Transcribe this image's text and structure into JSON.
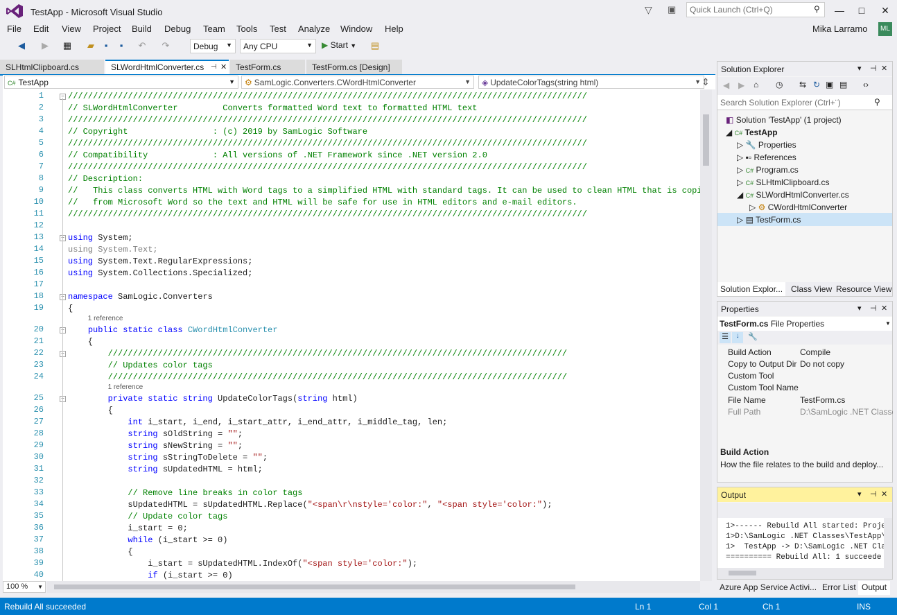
{
  "app": {
    "title": "TestApp - Microsoft Visual Studio",
    "quick_launch": "Quick Launch (Ctrl+Q)",
    "user": "Mika Larramo",
    "user_initials": "ML"
  },
  "menu": [
    "File",
    "Edit",
    "View",
    "Project",
    "Build",
    "Debug",
    "Team",
    "Tools",
    "Test",
    "Analyze",
    "Window",
    "Help"
  ],
  "toolbar": {
    "config": "Debug",
    "platform": "Any CPU",
    "start": "Start"
  },
  "tabs": [
    "SLHtmlClipboard.cs",
    "SLWordHtmlConverter.cs",
    "TestForm.cs",
    "TestForm.cs [Design]"
  ],
  "nav": {
    "project": "TestApp",
    "class": "SamLogic.Converters.CWordHtmlConverter",
    "member": "UpdateColorTags(string html)"
  },
  "code": [
    {
      "n": "1",
      "fold": "−",
      "t": "////////////////////////////////////////////////////////////////////////////////////////////////////////",
      "c": "cm"
    },
    {
      "n": "2",
      "t": "// SLWordHtmlConverter         Converts formatted Word text to formatted HTML text",
      "c": "cm"
    },
    {
      "n": "3",
      "t": "////////////////////////////////////////////////////////////////////////////////////////////////////////",
      "c": "cm"
    },
    {
      "n": "4",
      "t": "// Copyright                 : (c) 2019 by SamLogic Software",
      "c": "cm"
    },
    {
      "n": "5",
      "t": "////////////////////////////////////////////////////////////////////////////////////////////////////////",
      "c": "cm"
    },
    {
      "n": "6",
      "t": "// Compatibility             : All versions of .NET Framework since .NET version 2.0",
      "c": "cm"
    },
    {
      "n": "7",
      "t": "////////////////////////////////////////////////////////////////////////////////////////////////////////",
      "c": "cm"
    },
    {
      "n": "8",
      "t": "// Description:",
      "c": "cm"
    },
    {
      "n": "9",
      "t": "//   This class converts HTML with Word tags to a simplified HTML with standard tags. It can be used to clean HTML that is copied",
      "c": "cm"
    },
    {
      "n": "10",
      "t": "//   from Microsoft Word so the text and HTML will be safe for use in HTML editors and e-mail editors.",
      "c": "cm"
    },
    {
      "n": "11",
      "t": "////////////////////////////////////////////////////////////////////////////////////////////////////////",
      "c": "cm"
    },
    {
      "n": "12",
      "t": ""
    },
    {
      "n": "13",
      "fold": "−",
      "k": "using",
      "t": " System;"
    },
    {
      "n": "14",
      "gk": "using",
      "g": " System.Text;"
    },
    {
      "n": "15",
      "k": "using",
      "t": " System.Text.RegularExpressions;"
    },
    {
      "n": "16",
      "k": "using",
      "t": " System.Collections.Specialized;"
    },
    {
      "n": "17",
      "t": ""
    },
    {
      "n": "18",
      "fold": "−",
      "k": "namespace",
      "t": " SamLogic.Converters"
    },
    {
      "n": "19",
      "t": "{"
    },
    {
      "ref": "1 reference",
      "indent": 4
    },
    {
      "n": "20",
      "fold": "−",
      "pre": "    ",
      "k": "public static class",
      "ty": " CWordHtmlConverter"
    },
    {
      "n": "21",
      "t": "    {"
    },
    {
      "n": "22",
      "fold": "−",
      "pre": "        ",
      "t": "////////////////////////////////////////////////////////////////////////////////////////////",
      "c": "cm"
    },
    {
      "n": "23",
      "pre": "        ",
      "t": "// Updates color tags",
      "c": "cm"
    },
    {
      "n": "24",
      "pre": "        ",
      "t": "////////////////////////////////////////////////////////////////////////////////////////////",
      "c": "cm"
    },
    {
      "ref": "1 reference",
      "indent": 8
    },
    {
      "n": "25",
      "fold": "−",
      "pre": "        ",
      "k": "private static string",
      "t": " UpdateColorTags(",
      "k2": "string",
      "t2": " html)"
    },
    {
      "n": "26",
      "t": "        {"
    },
    {
      "n": "27",
      "pre": "            ",
      "k": "int",
      "t": " i_start, i_end, i_start_attr, i_end_attr, i_middle_tag, len;"
    },
    {
      "n": "28",
      "pre": "            ",
      "k": "string",
      "t": " sOldString = ",
      "s": "\"\"",
      "t2": ";"
    },
    {
      "n": "29",
      "pre": "            ",
      "k": "string",
      "t": " sNewString = ",
      "s": "\"\"",
      "t2": ";"
    },
    {
      "n": "30",
      "pre": "            ",
      "k": "string",
      "t": " sStringToDelete = ",
      "s": "\"\"",
      "t2": ";"
    },
    {
      "n": "31",
      "pre": "            ",
      "k": "string",
      "t": " sUpdatedHTML = html;"
    },
    {
      "n": "32",
      "t": ""
    },
    {
      "n": "33",
      "pre": "            ",
      "t": "// Remove line breaks in color tags",
      "c": "cm"
    },
    {
      "n": "34",
      "pre": "            ",
      "t": "sUpdatedHTML = sUpdatedHTML.Replace(",
      "s": "\"<span\\r\\nstyle='color:\"",
      "t2": ", ",
      "s2": "\"<span style='color:\"",
      "t3": ");"
    },
    {
      "n": "35",
      "pre": "            ",
      "t": "// Update color tags",
      "c": "cm"
    },
    {
      "n": "36",
      "pre": "            ",
      "t": "i_start = 0;"
    },
    {
      "n": "37",
      "pre": "            ",
      "k": "while",
      "t": " (i_start >= 0)"
    },
    {
      "n": "38",
      "t": "            {"
    },
    {
      "n": "39",
      "pre": "                ",
      "t": "i_start = sUpdatedHTML.IndexOf(",
      "s": "\"<span style='color:\"",
      "t2": ");"
    },
    {
      "n": "40",
      "pre": "                ",
      "k": "if",
      "t": " (i_start >= 0)"
    }
  ],
  "zoom": "100 %",
  "solution_explorer": {
    "title": "Solution Explorer",
    "search": "Search Solution Explorer (Ctrl+¨)",
    "items": [
      {
        "label": "Solution 'TestApp' (1 project)",
        "icon": "solution-icon"
      },
      {
        "label": "TestApp",
        "icon": "csharp-project-icon"
      },
      {
        "label": "Properties",
        "icon": "wrench-icon"
      },
      {
        "label": "References",
        "icon": "references-icon"
      },
      {
        "label": "Program.cs",
        "icon": "csharp-file-icon"
      },
      {
        "label": "SLHtmlClipboard.cs",
        "icon": "csharp-file-icon"
      },
      {
        "label": "SLWordHtmlConverter.cs",
        "icon": "csharp-file-icon"
      },
      {
        "label": "CWordHtmlConverter",
        "icon": "class-icon"
      },
      {
        "label": "TestForm.cs",
        "icon": "form-icon"
      }
    ],
    "tabs": [
      "Solution Explor...",
      "Class View",
      "Resource View"
    ]
  },
  "properties": {
    "title": "Properties",
    "object": "TestForm.cs",
    "object_type": "File Properties",
    "rows": [
      {
        "name": "Build Action",
        "value": "Compile"
      },
      {
        "name": "Copy to Output Dir",
        "value": "Do not copy"
      },
      {
        "name": "Custom Tool",
        "value": ""
      },
      {
        "name": "Custom Tool Name",
        "value": ""
      },
      {
        "name": "File Name",
        "value": "TestForm.cs"
      },
      {
        "name": "Full Path",
        "value": "D:\\SamLogic .NET Classes"
      }
    ],
    "desc_title": "Build Action",
    "desc_text": "How the file relates to the build and deploy..."
  },
  "output": {
    "title": "Output",
    "lines": [
      "1>------ Rebuild All started: Proje",
      "1>D:\\SamLogic .NET Classes\\TestApp\\",
      "1>  TestApp -> D:\\SamLogic .NET Cla",
      "========== Rebuild All: 1 succeede"
    ],
    "tabs": [
      "Azure App Service Activi...",
      "Error List",
      "Output"
    ]
  },
  "status": {
    "message": "Rebuild All succeeded",
    "ln": "Ln 1",
    "col": "Col 1",
    "ch": "Ch 1",
    "mode": "INS"
  },
  "colors": {
    "accent": "#007acc",
    "output_header": "#fff29d",
    "comment": "#008000",
    "keyword": "#0000ff"
  }
}
